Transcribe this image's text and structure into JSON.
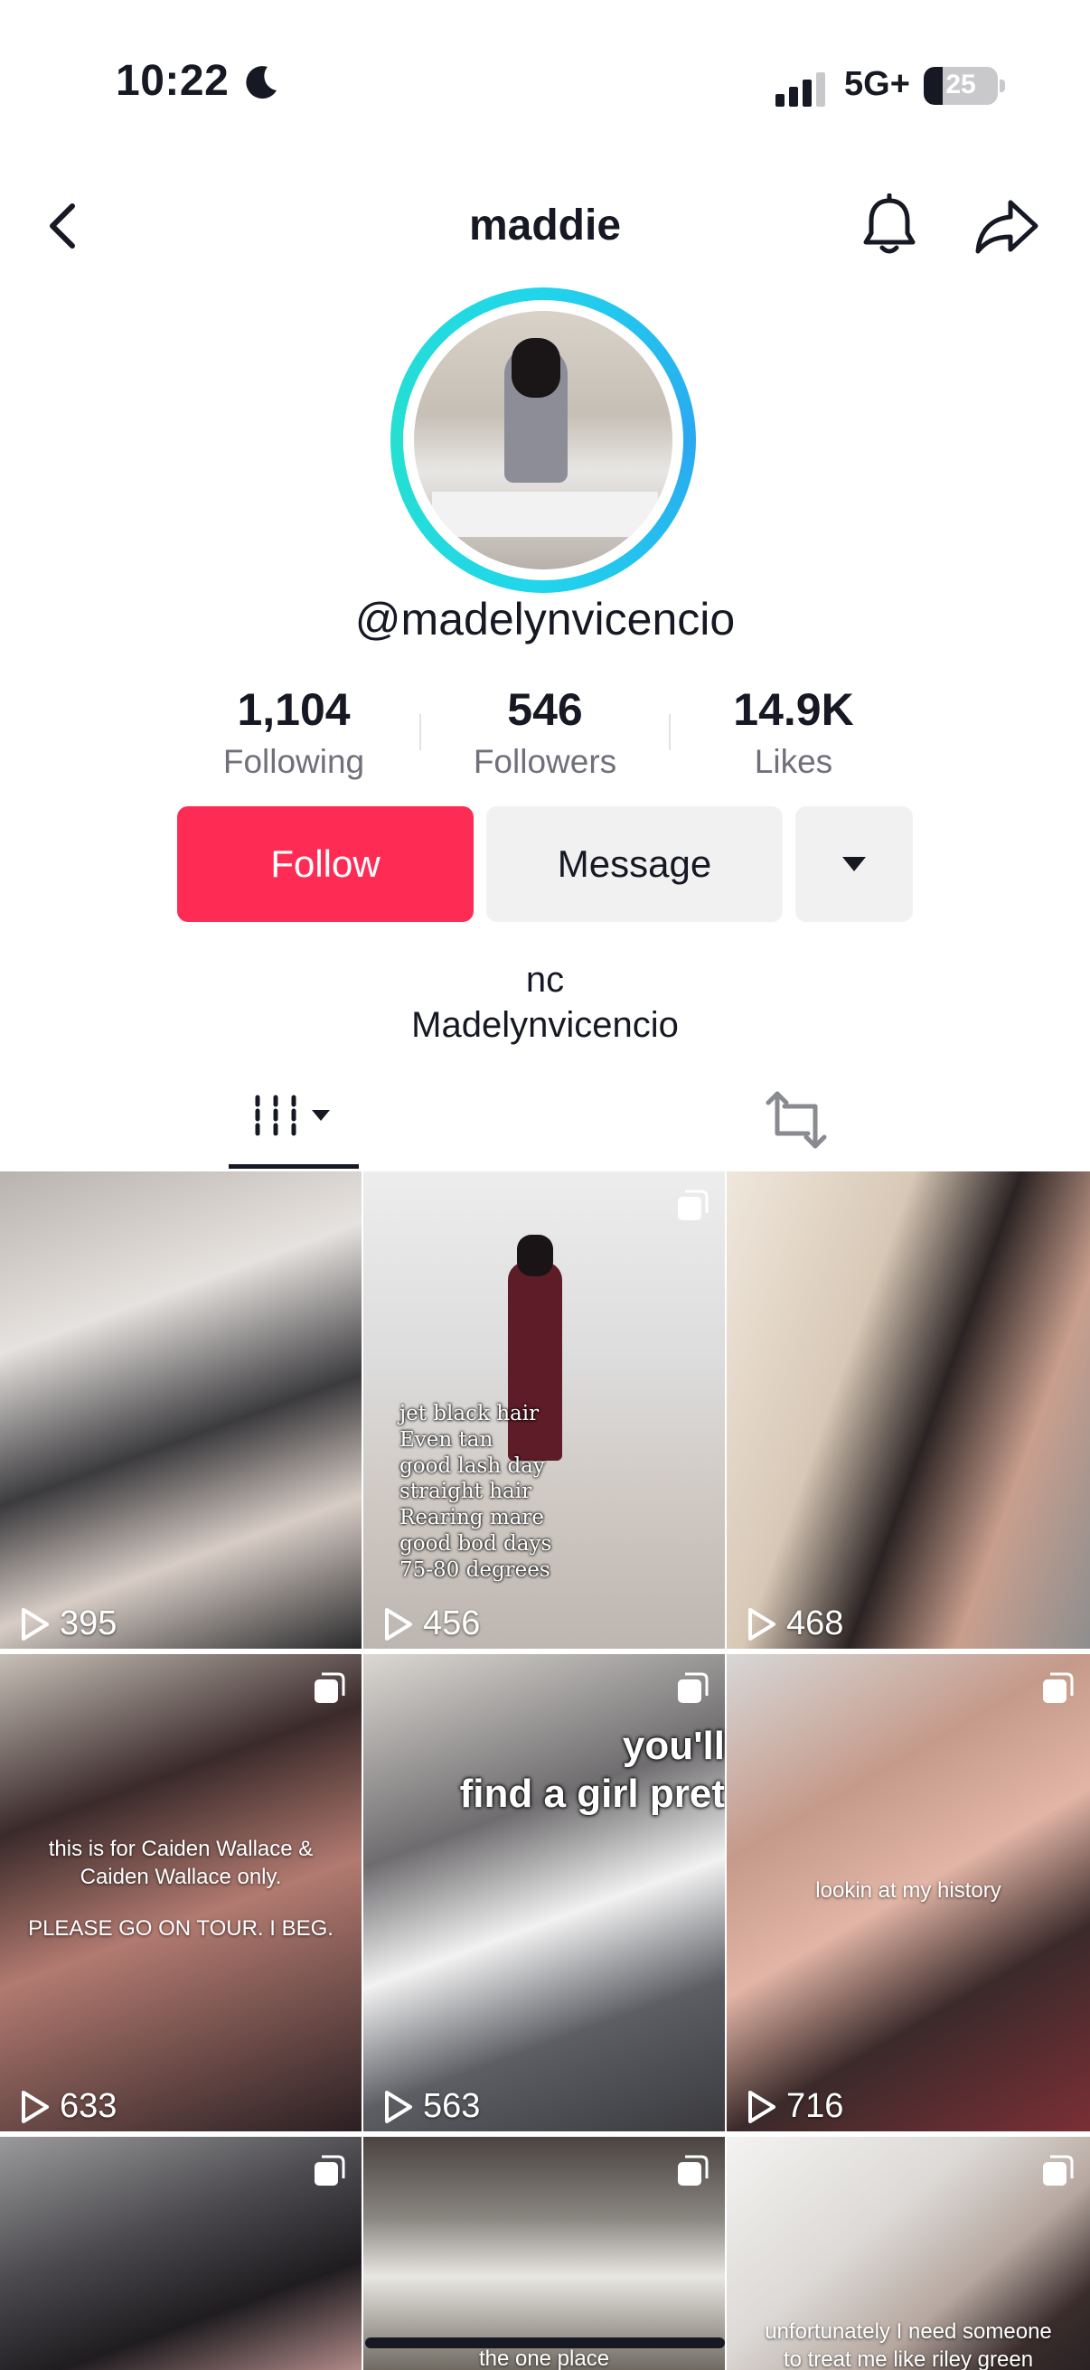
{
  "status_bar": {
    "time": "10:22",
    "network": "5G+",
    "battery_percent": "25",
    "battery_level": 0.25,
    "icons": [
      "moon-icon",
      "signal-bars-icon",
      "battery-icon"
    ]
  },
  "header": {
    "title": "maddie",
    "icons": [
      "chevron-left-icon",
      "bell-icon",
      "share-arrow-icon"
    ]
  },
  "profile": {
    "handle": "@madelynvicencio",
    "avatar_ring_color": "#20d5ec"
  },
  "stats": [
    {
      "value": "1,104",
      "label": "Following"
    },
    {
      "value": "546",
      "label": "Followers"
    },
    {
      "value": "14.9K",
      "label": "Likes"
    }
  ],
  "actions": {
    "follow_label": "Follow",
    "message_label": "Message",
    "follow_color": "#fe2c55"
  },
  "bio": {
    "line1": "nc",
    "line2": "Madelynvicencio"
  },
  "tabs": {
    "icons": [
      "grid-bars-icon",
      "repost-icon"
    ],
    "active": "videos"
  },
  "videos": [
    {
      "views": "395",
      "caption": ""
    },
    {
      "views": "456",
      "caption_lines": [
        "jet black hair",
        "Even tan",
        "good lash day",
        "straight hair",
        "Rearing mare",
        "good bod days",
        "75-80 degrees"
      ]
    },
    {
      "views": "468",
      "caption": ""
    },
    {
      "views": "633",
      "caption_lines": [
        "this is for Caiden Wallace &",
        "Caiden Wallace only.",
        "",
        "PLEASE GO ON TOUR. I BEG."
      ]
    },
    {
      "views": "563",
      "caption_lines": [
        "you'll",
        "find a girl pret"
      ]
    },
    {
      "views": "716",
      "caption_lines": [
        "lookin at my history"
      ]
    },
    {
      "views": "",
      "caption": ""
    },
    {
      "views": "",
      "caption_lines": [
        "the one place"
      ]
    },
    {
      "views": "",
      "caption_lines": [
        "unfortunately I need someone",
        "to treat me like riley green"
      ]
    }
  ]
}
